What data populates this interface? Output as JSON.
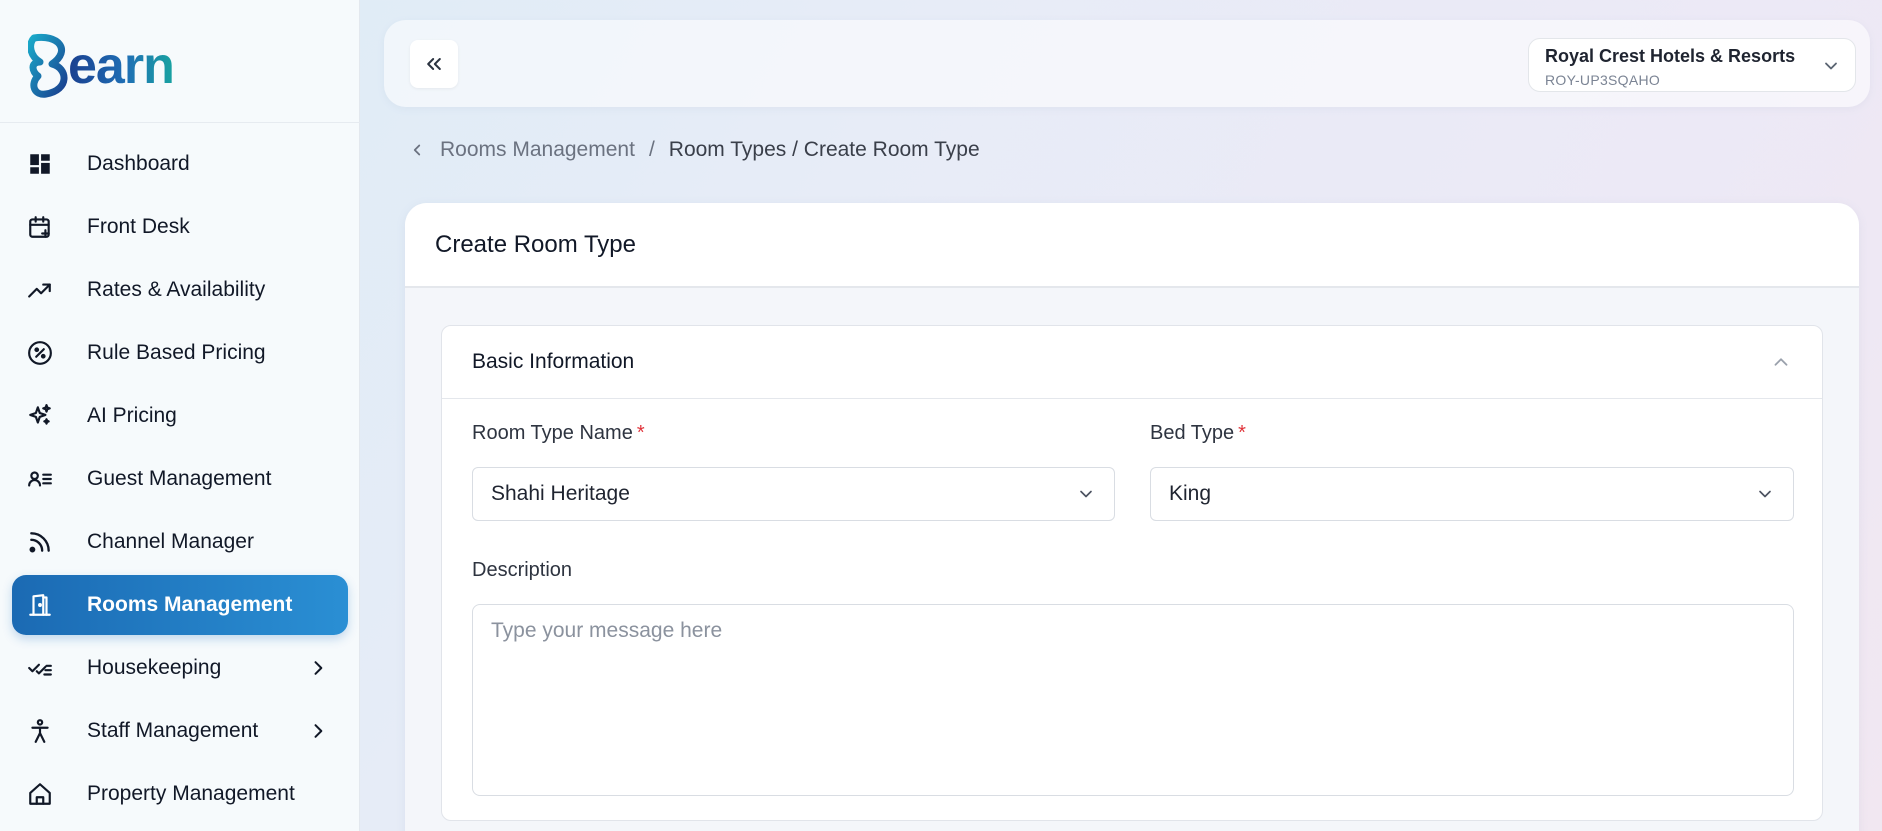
{
  "brand": {
    "logo_text": "earn",
    "colors": {
      "primary": "#1b6ab3",
      "accent": "#2a8fd4",
      "teal": "#18a3a0",
      "required": "#e0333a"
    }
  },
  "sidebar": {
    "items": [
      {
        "label": "Dashboard",
        "icon": "dashboard-icon",
        "active": false,
        "has_submenu": false
      },
      {
        "label": "Front Desk",
        "icon": "calendar-plus-icon",
        "active": false,
        "has_submenu": false
      },
      {
        "label": "Rates & Availability",
        "icon": "trending-up-icon",
        "active": false,
        "has_submenu": false
      },
      {
        "label": "Rule Based Pricing",
        "icon": "percent-circle-icon",
        "active": false,
        "has_submenu": false
      },
      {
        "label": "AI Pricing",
        "icon": "sparkles-icon",
        "active": false,
        "has_submenu": false
      },
      {
        "label": "Guest Management",
        "icon": "user-list-icon",
        "active": false,
        "has_submenu": false
      },
      {
        "label": "Channel Manager",
        "icon": "rss-icon",
        "active": false,
        "has_submenu": false
      },
      {
        "label": "Rooms Management",
        "icon": "door-icon",
        "active": true,
        "has_submenu": false
      },
      {
        "label": "Housekeeping",
        "icon": "checklist-icon",
        "active": false,
        "has_submenu": true
      },
      {
        "label": "Staff Management",
        "icon": "person-icon",
        "active": false,
        "has_submenu": true
      },
      {
        "label": "Property Management",
        "icon": "home-icon",
        "active": false,
        "has_submenu": false
      }
    ]
  },
  "topbar": {
    "collapse_icon": "chevrons-left-icon",
    "hotel": {
      "name": "Royal Crest Hotels & Resorts",
      "code": "ROY-UP3SQAHO"
    }
  },
  "breadcrumb": {
    "parent": "Rooms Management",
    "separator": "/",
    "current": "Room Types / Create Room Type"
  },
  "form": {
    "title": "Create Room Type",
    "section_title": "Basic Information",
    "room_type_name": {
      "label": "Room Type Name",
      "required_mark": "*",
      "value": "Shahi Heritage"
    },
    "bed_type": {
      "label": "Bed Type",
      "required_mark": "*",
      "value": "King"
    },
    "description": {
      "label": "Description",
      "placeholder": "Type your message here"
    }
  }
}
